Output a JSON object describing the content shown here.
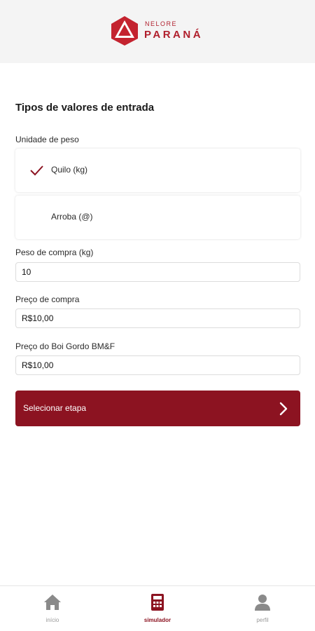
{
  "header": {
    "brand_small": "NELORE",
    "brand_big": "PARANÁ",
    "logo_icon": "hexagon-triangle-logo",
    "brand_color": "#b01f2c"
  },
  "form": {
    "section_title": "Tipos de valores de entrada",
    "weight_unit_label": "Unidade de peso",
    "weight_unit_options": [
      {
        "label": "Quilo (kg)",
        "selected": true
      },
      {
        "label": "Arroba (@)",
        "selected": false
      }
    ],
    "purchase_weight": {
      "label": "Peso de compra (kg)",
      "value": "10"
    },
    "purchase_price": {
      "label": "Preço de compra",
      "value": "R$10,00"
    },
    "bmf_price": {
      "label": "Preço do Boi Gordo BM&F",
      "value": "R$10,00"
    },
    "select_stage_button": {
      "label": "Selecionar etapa",
      "icon": "chevron-right-icon",
      "color": "#8c1321"
    }
  },
  "tabbar": {
    "tabs": [
      {
        "label": "início",
        "icon": "home-icon",
        "active": false
      },
      {
        "label": "simulador",
        "icon": "calculator-icon",
        "active": true
      },
      {
        "label": "perfil",
        "icon": "user-icon",
        "active": false
      }
    ],
    "active_color": "#8c1321",
    "inactive_color": "#8a8a8a"
  }
}
